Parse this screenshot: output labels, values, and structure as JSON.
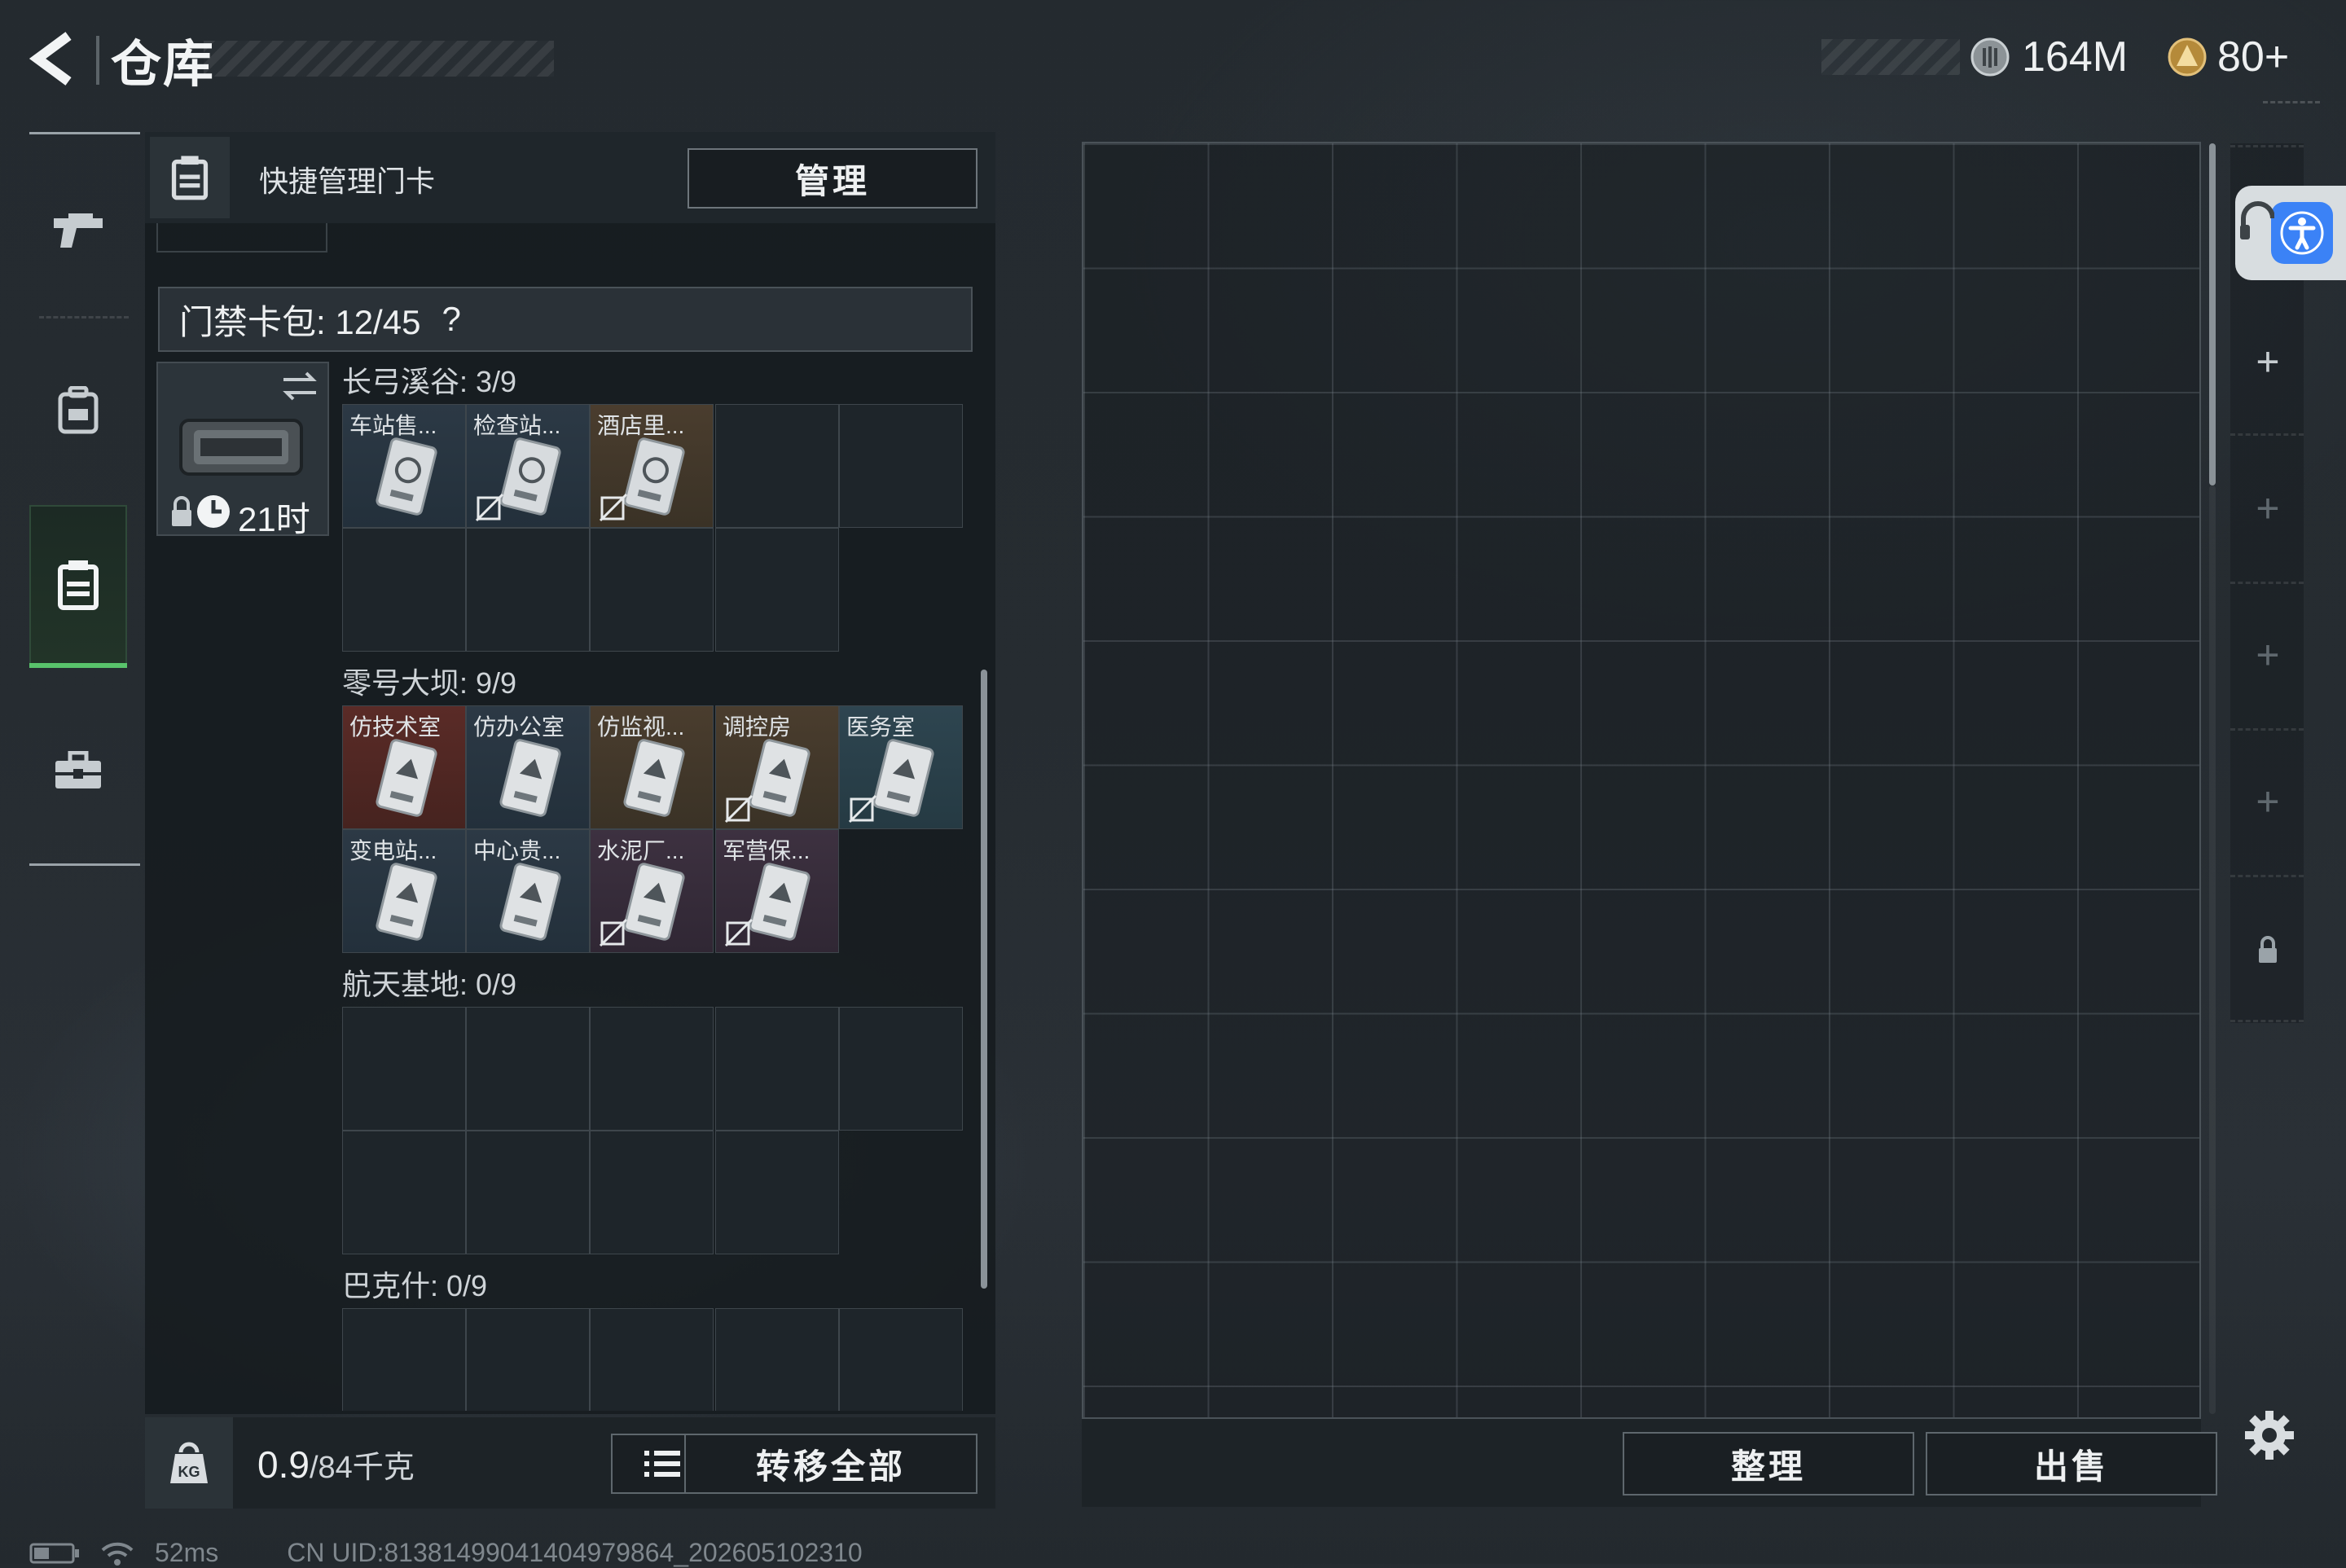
{
  "header": {
    "title": "仓库",
    "currency_silver": "164M",
    "currency_gold": "80+"
  },
  "sidebar": {
    "items": [
      {
        "name": "weapons",
        "icon": "pistol-icon",
        "active": false
      },
      {
        "name": "equipment",
        "icon": "backpack-icon",
        "active": false
      },
      {
        "name": "keycards",
        "icon": "keycard-icon",
        "active": true
      },
      {
        "name": "supplies",
        "icon": "briefcase-icon",
        "active": false
      }
    ]
  },
  "keycard_panel": {
    "header_label": "快捷管理门卡",
    "manage_button": "管理",
    "count_label": "门禁卡包: 12/45",
    "help": "?",
    "card_pack_timer": "21时",
    "regions": [
      {
        "title": "长弓溪谷: 3/9",
        "cards": [
          {
            "name": "车站售...",
            "color": "blue",
            "marked": false
          },
          {
            "name": "检查站...",
            "color": "blue",
            "marked": true
          },
          {
            "name": "酒店里...",
            "color": "gold",
            "marked": true
          }
        ]
      },
      {
        "title": "零号大坝: 9/9",
        "cards": [
          {
            "name": "仿技术室",
            "color": "red",
            "marked": false
          },
          {
            "name": "仿办公室",
            "color": "blue",
            "marked": false
          },
          {
            "name": "仿监视...",
            "color": "gold",
            "marked": false
          },
          {
            "name": "调控房",
            "color": "gold",
            "marked": true
          },
          {
            "name": "医务室",
            "color": "cyan",
            "marked": true
          },
          {
            "name": "变电站...",
            "color": "blue",
            "marked": false
          },
          {
            "name": "中心贵...",
            "color": "blue",
            "marked": false
          },
          {
            "name": "水泥厂...",
            "color": "purple",
            "marked": true
          },
          {
            "name": "军营保...",
            "color": "purple",
            "marked": true
          }
        ]
      },
      {
        "title": "航天基地: 0/9",
        "cards": []
      },
      {
        "title": "巴克什: 0/9",
        "cards": []
      }
    ]
  },
  "bottom_left": {
    "weight_current": "0.9",
    "weight_max": "/84千克",
    "transfer_all": "转移全部"
  },
  "bottom_right": {
    "sort_button": "整理",
    "sell_button": "出售"
  },
  "status_bar": {
    "ping": "52ms",
    "uid": "CN UID:81381499041404979864_202605102310"
  },
  "colors": {
    "accent_green": "#59c36b",
    "accessibility_blue": "#3b82f6"
  }
}
